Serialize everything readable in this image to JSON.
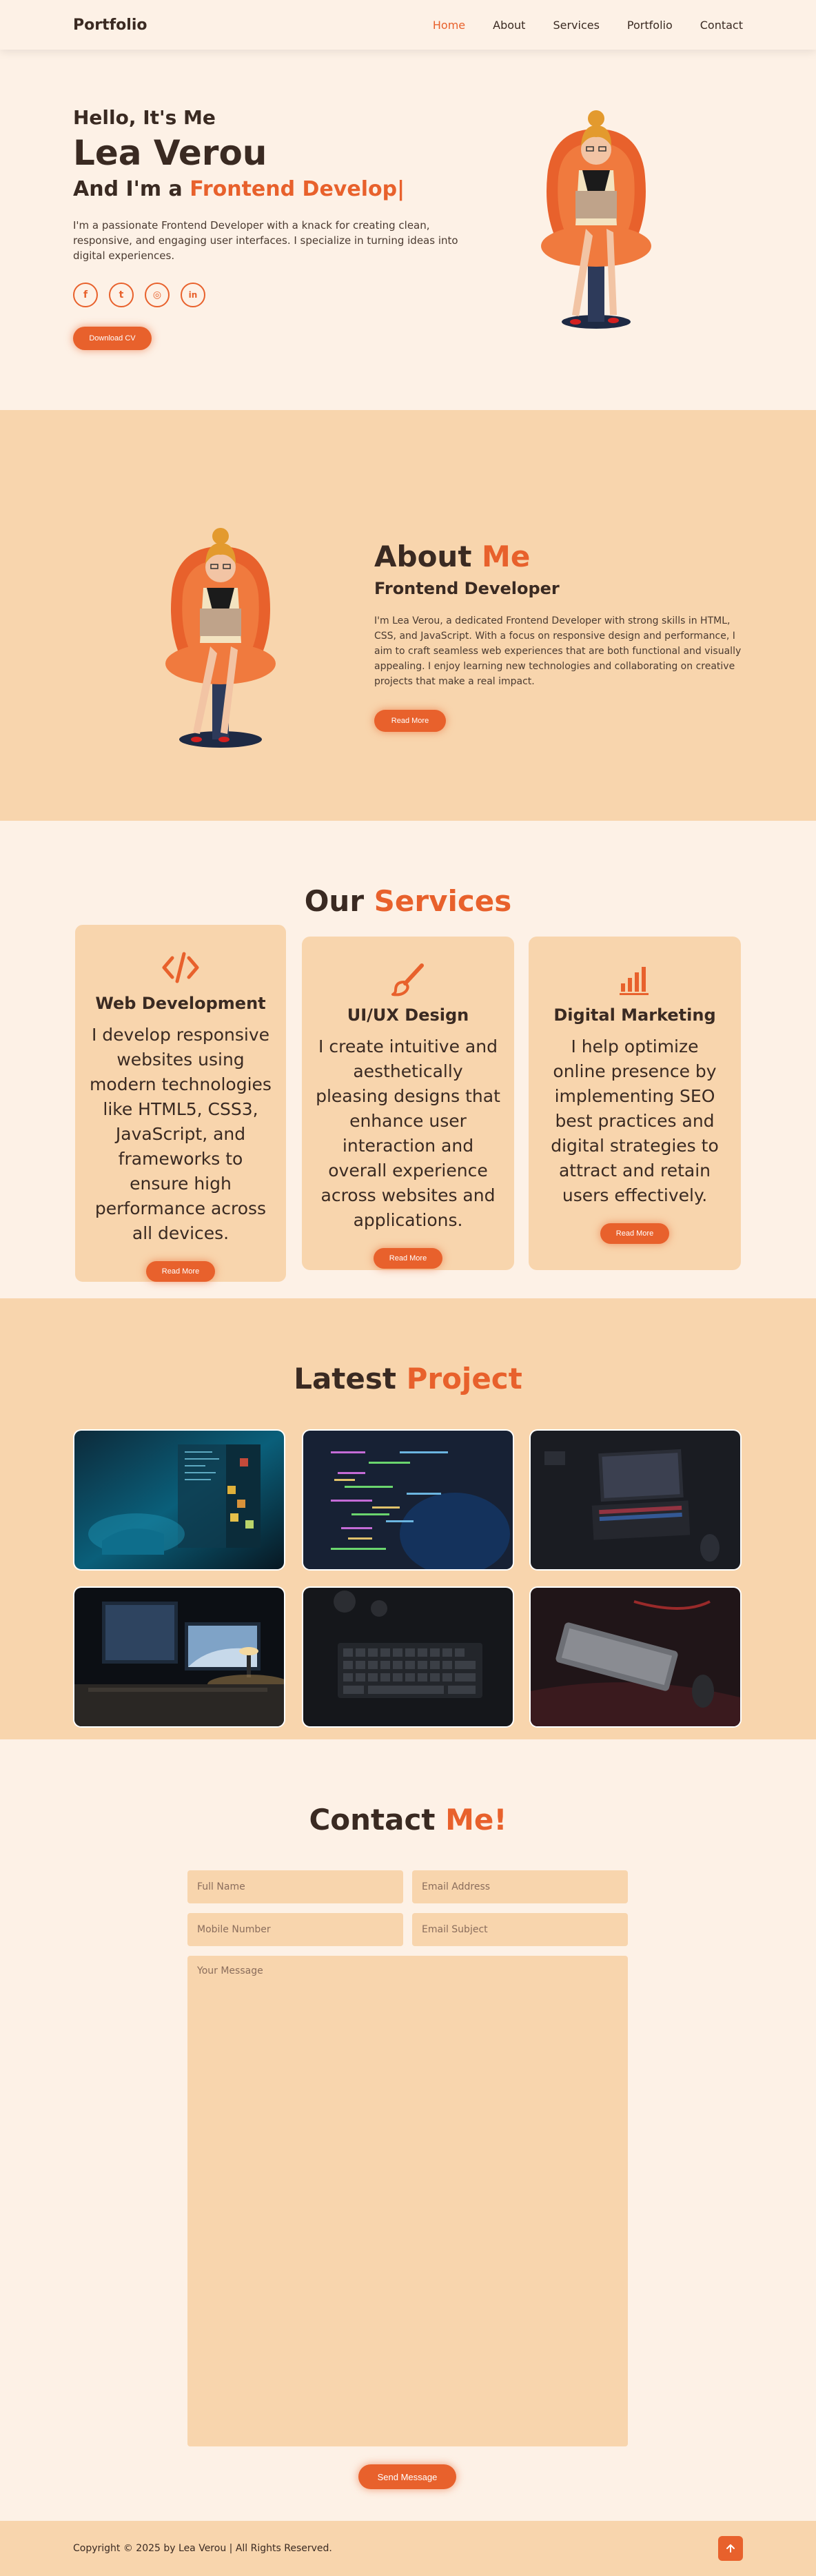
{
  "header": {
    "logo": "Portfolio",
    "nav": [
      {
        "label": "Home",
        "active": true
      },
      {
        "label": "About",
        "active": false
      },
      {
        "label": "Services",
        "active": false
      },
      {
        "label": "Portfolio",
        "active": false
      },
      {
        "label": "Contact",
        "active": false
      }
    ]
  },
  "hero": {
    "hello": "Hello, It's Me",
    "name": "Lea Verou",
    "role_prefix": "And I'm a",
    "role_typed": "Frontend Develop|",
    "description": "I'm a passionate Frontend Developer with a knack for creating clean, responsive, and engaging user interfaces. I specialize in turning ideas into digital experiences.",
    "socials": [
      {
        "icon": "facebook-icon",
        "glyph": "f"
      },
      {
        "icon": "twitter-icon",
        "glyph": "t"
      },
      {
        "icon": "instagram-icon",
        "glyph": "◎"
      },
      {
        "icon": "linkedin-icon",
        "glyph": "in"
      }
    ],
    "cv_button": "Download CV"
  },
  "about": {
    "title_plain": "About",
    "title_accent": "Me",
    "subtitle": "Frontend Developer",
    "description": "I'm Lea Verou, a dedicated Frontend Developer with strong skills in HTML, CSS, and JavaScript. With a focus on responsive design and performance, I aim to craft seamless web experiences that are both functional and visually appealing. I enjoy learning new technologies and collaborating on creative projects that make a real impact.",
    "button": "Read More"
  },
  "services": {
    "title_plain": "Our",
    "title_accent": "Services",
    "cards": [
      {
        "icon": "code-icon",
        "title": "Web Development",
        "description": "I develop responsive websites using modern technologies like HTML5, CSS3, JavaScript, and frameworks to ensure high performance across all devices.",
        "button": "Read More"
      },
      {
        "icon": "brush-icon",
        "title": "UI/UX Design",
        "description": "I create intuitive and aesthetically pleasing designs that enhance user interaction and overall experience across websites and applications.",
        "button": "Read More"
      },
      {
        "icon": "bar-chart-icon",
        "title": "Digital Marketing",
        "description": "I help optimize online presence by implementing SEO best practices and digital strategies to attract and retain users effectively.",
        "button": "Read More"
      }
    ]
  },
  "projects": {
    "title_plain": "Latest",
    "title_accent": "Project",
    "items": [
      {
        "name": "project-hacker-screens"
      },
      {
        "name": "project-code-screen"
      },
      {
        "name": "project-laptop-desk"
      },
      {
        "name": "project-imac-desk"
      },
      {
        "name": "project-keyboard-top"
      },
      {
        "name": "project-keyboard-dark"
      }
    ]
  },
  "contact": {
    "title_plain": "Contact",
    "title_accent": "Me!",
    "fields": {
      "full_name": "Full Name",
      "email": "Email Address",
      "mobile": "Mobile Number",
      "subject": "Email Subject",
      "message": "Your Message"
    },
    "send_button": "Send Message"
  },
  "footer": {
    "copyright": "Copyright © 2025 by Lea Verou | All Rights Reserved.",
    "top_icon": "arrow-up-icon"
  },
  "colors": {
    "accent": "#e8612c",
    "cream": "#fdf1e6",
    "peach": "#f8d5ad",
    "dark": "#3a2a22"
  }
}
